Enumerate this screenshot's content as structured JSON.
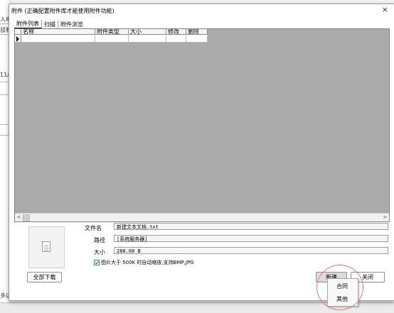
{
  "background": {
    "fragments": [
      "入申",
      "驳制",
      "11/",
      "多达"
    ]
  },
  "dialog": {
    "title": "附件 (正确配置附件库才能使用附件功能)",
    "close_glyph": "×",
    "tabs": [
      {
        "label": "附件列表",
        "active": true
      },
      {
        "label": "扫描",
        "active": false
      },
      {
        "label": "附件浏览",
        "active": false
      }
    ],
    "grid": {
      "columns": [
        "名称",
        "附件类型",
        "大小",
        "修改",
        "删除"
      ],
      "rows": 1
    },
    "scrollbar": {
      "left": "<",
      "right": ">"
    },
    "info": {
      "filename_label": "文件名",
      "filename_value": "新建文本文档.txt",
      "path_label": "路径",
      "path_value": "[系统服务器]",
      "size_label": "大小",
      "size_value": "280.00  B"
    },
    "option": {
      "checked": true,
      "label": "图片大于 500K 时自动缩放,支持BMP,JPG"
    },
    "buttons": {
      "download_all": "全部下载",
      "new": "新建",
      "close": "关闭"
    },
    "dropdown_menu": {
      "items": [
        "合同",
        "其他"
      ]
    }
  },
  "colors": {
    "highlight_circle": "#e07777",
    "grid_empty": "#ababab",
    "checkbox_accent": "#3a7bd5"
  }
}
